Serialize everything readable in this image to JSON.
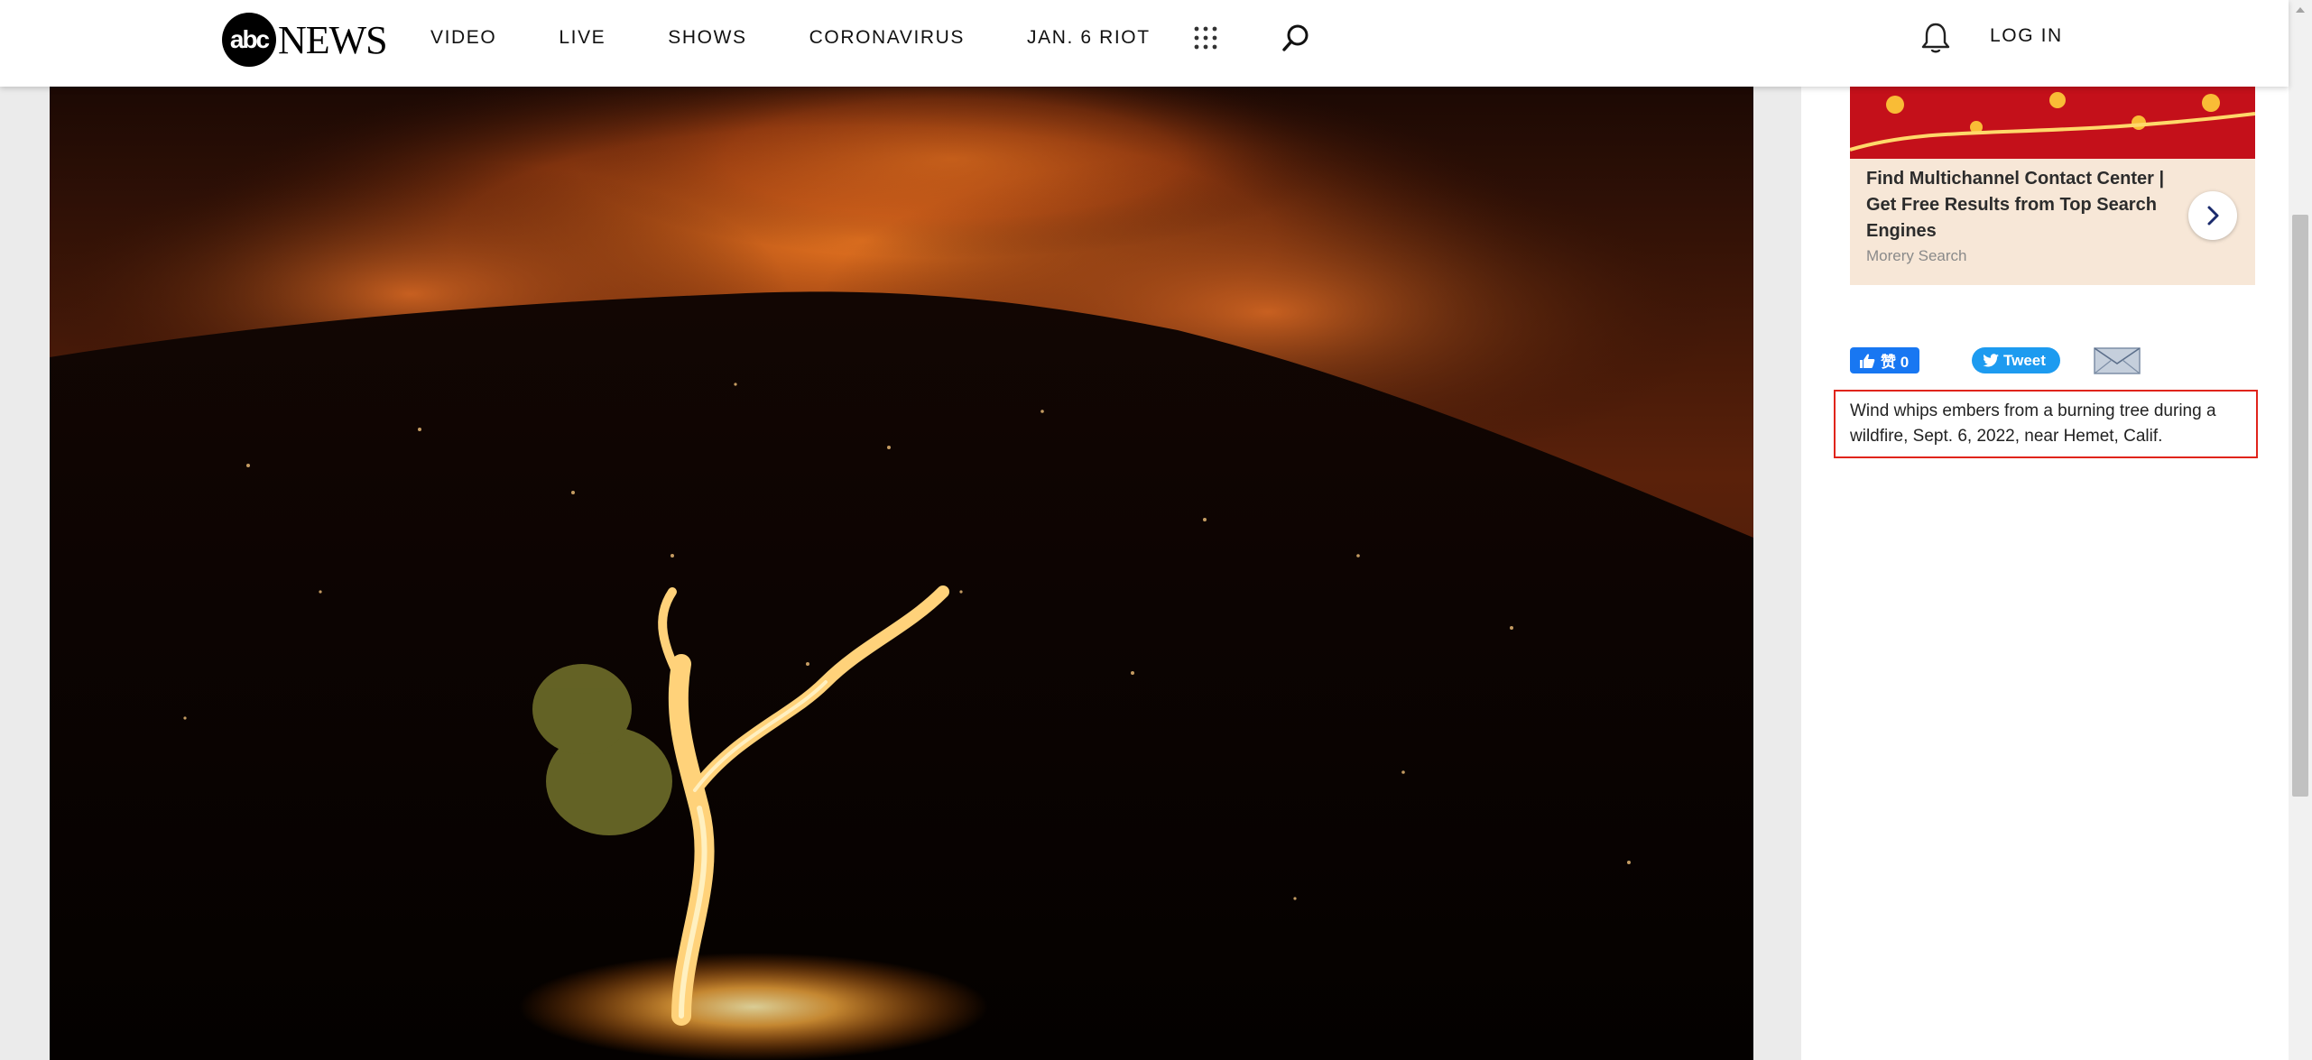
{
  "header": {
    "logo_mark": "abc",
    "logo_text": "NEWS",
    "nav": [
      {
        "label": "VIDEO"
      },
      {
        "label": "LIVE"
      },
      {
        "label": "SHOWS"
      },
      {
        "label": "CORONAVIRUS"
      },
      {
        "label": "JAN. 6 RIOT"
      }
    ],
    "icons": [
      "apps-grid-icon",
      "search-icon",
      "bell-icon"
    ],
    "login_label": "LOG IN"
  },
  "ad": {
    "title": "Find Multichannel Contact Center | Get Free Results from Top Search Engines",
    "source": "Morery Search",
    "arrow_icon": "chevron-right-icon"
  },
  "share": {
    "facebook_label": "赞 0",
    "tweet_label": "Tweet",
    "email_icon": "envelope-icon"
  },
  "caption": "Wind whips embers from a burning tree during a wildfire, Sept. 6, 2022, near Hemet, Calif.",
  "colors": {
    "header_bg": "#ffffff",
    "page_bg": "#ebebeb",
    "facebook_blue": "#1877f2",
    "twitter_blue": "#1d9bf0",
    "highlight_red": "#e0241b",
    "ad_bg": "#f7e7d7"
  }
}
